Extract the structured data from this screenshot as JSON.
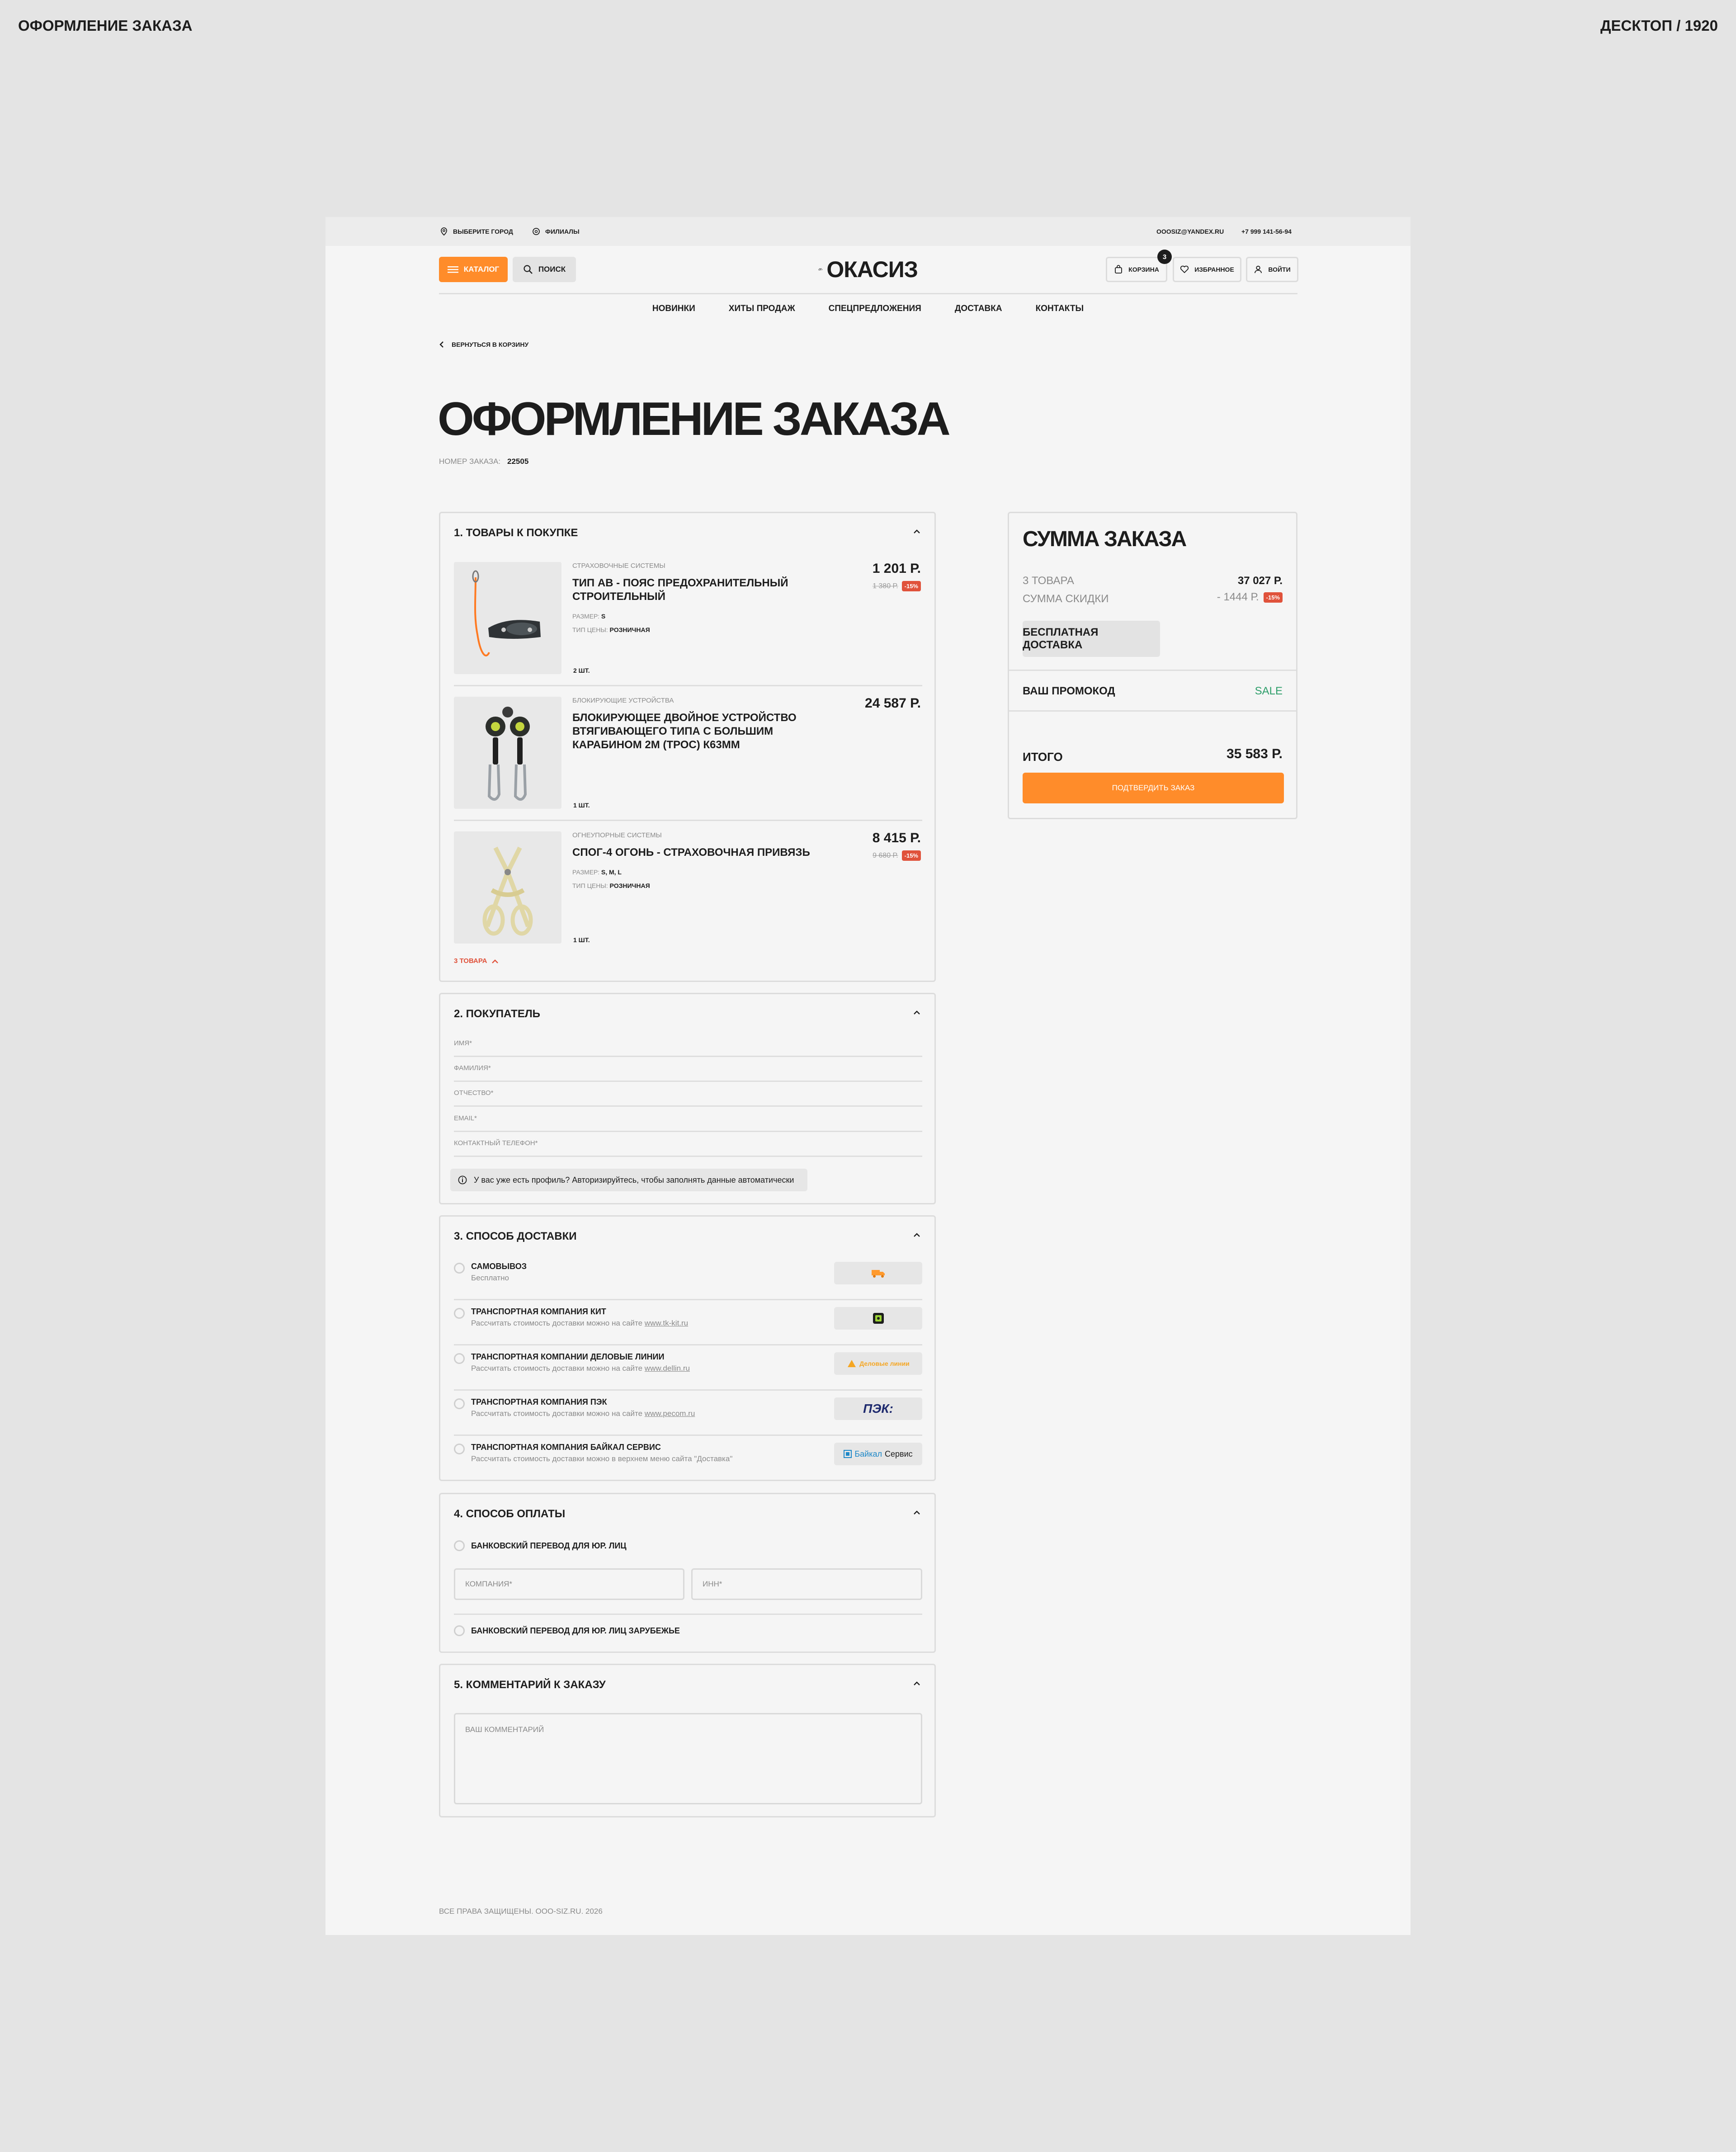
{
  "frame": {
    "title": "ОФОРМЛЕНИЕ ЗАКАЗА",
    "device": "ДЕСКТОП / 1920"
  },
  "topbar": {
    "city": "ВЫБЕРИТЕ ГОРОД",
    "branches": "ФИЛИАЛЫ",
    "email": "OOOSIZ@YANDEX.RU",
    "phone": "+7 999 141-56-94"
  },
  "header": {
    "catalog_label": "КАТАЛОГ",
    "search_label": "ПОИСК",
    "logo_text": "ОКАСИЗ",
    "cart_label": "КОРЗИНА",
    "cart_count": "3",
    "favorites_label": "ИЗБРАННОЕ",
    "login_label": "ВОЙТИ"
  },
  "nav": [
    "НОВИНКИ",
    "ХИТЫ ПРОДАЖ",
    "СПЕЦПРЕДЛОЖЕНИЯ",
    "ДОСТАВКА",
    "КОНТАКТЫ"
  ],
  "back_link": "ВЕРНУТЬСЯ В КОРЗИНУ",
  "page_title": "ОФОРМЛЕНИЕ ЗАКАЗА",
  "order": {
    "number_label": "НОМЕР ЗАКАЗА:",
    "number": "22505"
  },
  "products_section": {
    "title": "1. ТОВАРЫ К ПОКУПКЕ",
    "items": [
      {
        "category": "СТРАХОВОЧНЫЕ СИСТЕМЫ",
        "name_line1": "ТИП АВ - ПОЯС ПРЕДОХРАНИТЕЛЬНЫЙ",
        "name_line2": "СТРОИТЕЛЬНЫЙ",
        "size_label": "РАЗМЕР:",
        "size": "S",
        "price_type_label": "ТИП ЦЕНЫ:",
        "price_type": "РОЗНИЧНАЯ",
        "price": "1 201 Р.",
        "old_price": "1 380 Р.",
        "discount": "-15%",
        "qty": "2 ШТ."
      },
      {
        "category": "БЛОКИРУЮЩИЕ УСТРОЙСТВА",
        "name_line1": "БЛОКИРУЮЩЕЕ ДВОЙНОЕ УСТРОЙСТВО",
        "name_line2": "ВТЯГИВАЮЩЕГО ТИПА С БОЛЬШИМ",
        "name_line3": "КАРАБИНОМ 2М (ТРОС) К63ММ",
        "price": "24 587 Р.",
        "qty": "1 ШТ."
      },
      {
        "category": "ОГНЕУПОРНЫЕ СИСТЕМЫ",
        "name_line1": "СПОГ-4 ОГОНЬ - СТРАХОВОЧНАЯ ПРИВЯЗЬ",
        "size_label": "РАЗМЕР:",
        "size": "S, M, L",
        "price_type_label": "ТИП ЦЕНЫ:",
        "price_type": "РОЗНИЧНАЯ",
        "price": "8 415 Р.",
        "old_price": "9 680 Р.",
        "discount": "-15%",
        "qty": "1 ШТ."
      }
    ],
    "collapse_label": "3 ТОВАРА"
  },
  "buyer_section": {
    "title": "2. ПОКУПАТЕЛЬ",
    "fields": [
      "ИМЯ*",
      "ФАМИЛИЯ*",
      "ОТЧЕСТВО*",
      "EMAIL*",
      "КОНТАКТНЫЙ ТЕЛЕФОН*"
    ],
    "auth_hint": "У вас уже есть профиль? Авторизируйтесь, чтобы заполнять данные автоматически"
  },
  "delivery_section": {
    "title": "3. СПОСОБ ДОСТАВКИ",
    "options": [
      {
        "name": "САМОВЫВОЗ",
        "sub": "Бесплатно",
        "link": ""
      },
      {
        "name": "ТРАНСПОРТНАЯ КОМПАНИЯ КИТ",
        "sub": "Рассчитать стоимость доставки можно на сайте",
        "link": "www.tk-kit.ru"
      },
      {
        "name": "ТРАНСПОРТНАЯ КОМПАНИИ ДЕЛОВЫЕ ЛИНИИ",
        "sub": "Рассчитать стоимость доставки можно на сайте",
        "link": "www.dellin.ru"
      },
      {
        "name": "ТРАНСПОРТНАЯ КОМПАНИЯ ПЭК",
        "sub": "Рассчитать стоимость доставки можно на сайте",
        "link": "www.pecom.ru"
      },
      {
        "name": "ТРАНСПОРТНАЯ КОМПАНИЯ БАЙКАЛ СЕРВИС",
        "sub": "Рассчитать стоимость доставки можно в верхнем меню сайта \"Доставка\"",
        "link": ""
      }
    ],
    "logos": {
      "dellin": "Деловые линии",
      "pek": "ПЭК:",
      "baikal_1": "Байкал",
      "baikal_2": "Сервис"
    }
  },
  "payment_section": {
    "title": "4. СПОСОБ ОПЛАТЫ",
    "option1": "БАНКОВСКИЙ ПЕРЕВОД ДЛЯ ЮР. ЛИЦ",
    "company_placeholder": "КОМПАНИЯ*",
    "inn_placeholder": "ИНН*",
    "option2": "БАНКОВСКИЙ ПЕРЕВОД ДЛЯ ЮР. ЛИЦ ЗАРУБЕЖЬЕ"
  },
  "comment_section": {
    "title": "5. КОММЕНТАРИЙ К ЗАКАЗУ",
    "placeholder": "ВАШ КОММЕНТАРИЙ"
  },
  "summary": {
    "title": "СУММА ЗАКАЗА",
    "items_label": "3 ТОВАРА",
    "items_value": "37 027 Р.",
    "discount_label": "СУММА СКИДКИ",
    "discount_value": "- 1444 Р.",
    "discount_badge": "-15%",
    "free_delivery": "БЕСПЛАТНАЯ ДОСТАВКА",
    "promo_label": "ВАШ ПРОМОКОД",
    "promo_value": "SALE",
    "total_label": "ИТОГО",
    "total_value": "35 583 Р.",
    "confirm_label": "ПОДТВЕРДИТЬ ЗАКАЗ"
  },
  "footer": {
    "copyright": "ВСЕ ПРАВА ЗАЩИЩЕНЫ. OOO-SIZ.RU. 2026"
  },
  "colors": {
    "accent": "#ff8c2a",
    "sale_green": "#2e9e6a",
    "badge_red": "#e0523b"
  }
}
